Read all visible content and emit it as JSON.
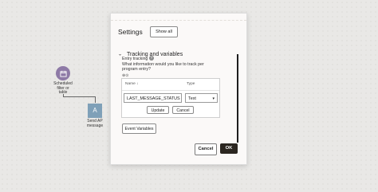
{
  "canvas": {
    "node1": {
      "label_lines": [
        "Scheduled",
        "filter or",
        "table"
      ]
    },
    "node2": {
      "icon": "A",
      "label_lines": [
        "Send AP",
        "message"
      ]
    }
  },
  "dialog": {
    "title": "Settings",
    "show_all": "Show all",
    "section": {
      "title": "Tracking and variables",
      "entry_tracking_label": "Entry tracking",
      "question": "What information would you like to track per program entry?",
      "tiny_icons": "⊕⊙",
      "table": {
        "col_name": "Name ↓",
        "col_type": "Type",
        "name_value": "LAST_MESSAGE_STATUS",
        "type_value": "Text",
        "update_label": "Update",
        "cancel_label": "Cancel"
      },
      "event_variables_label": "Event Variables"
    },
    "footer": {
      "cancel_label": "Cancel",
      "ok_label": "OK"
    }
  }
}
